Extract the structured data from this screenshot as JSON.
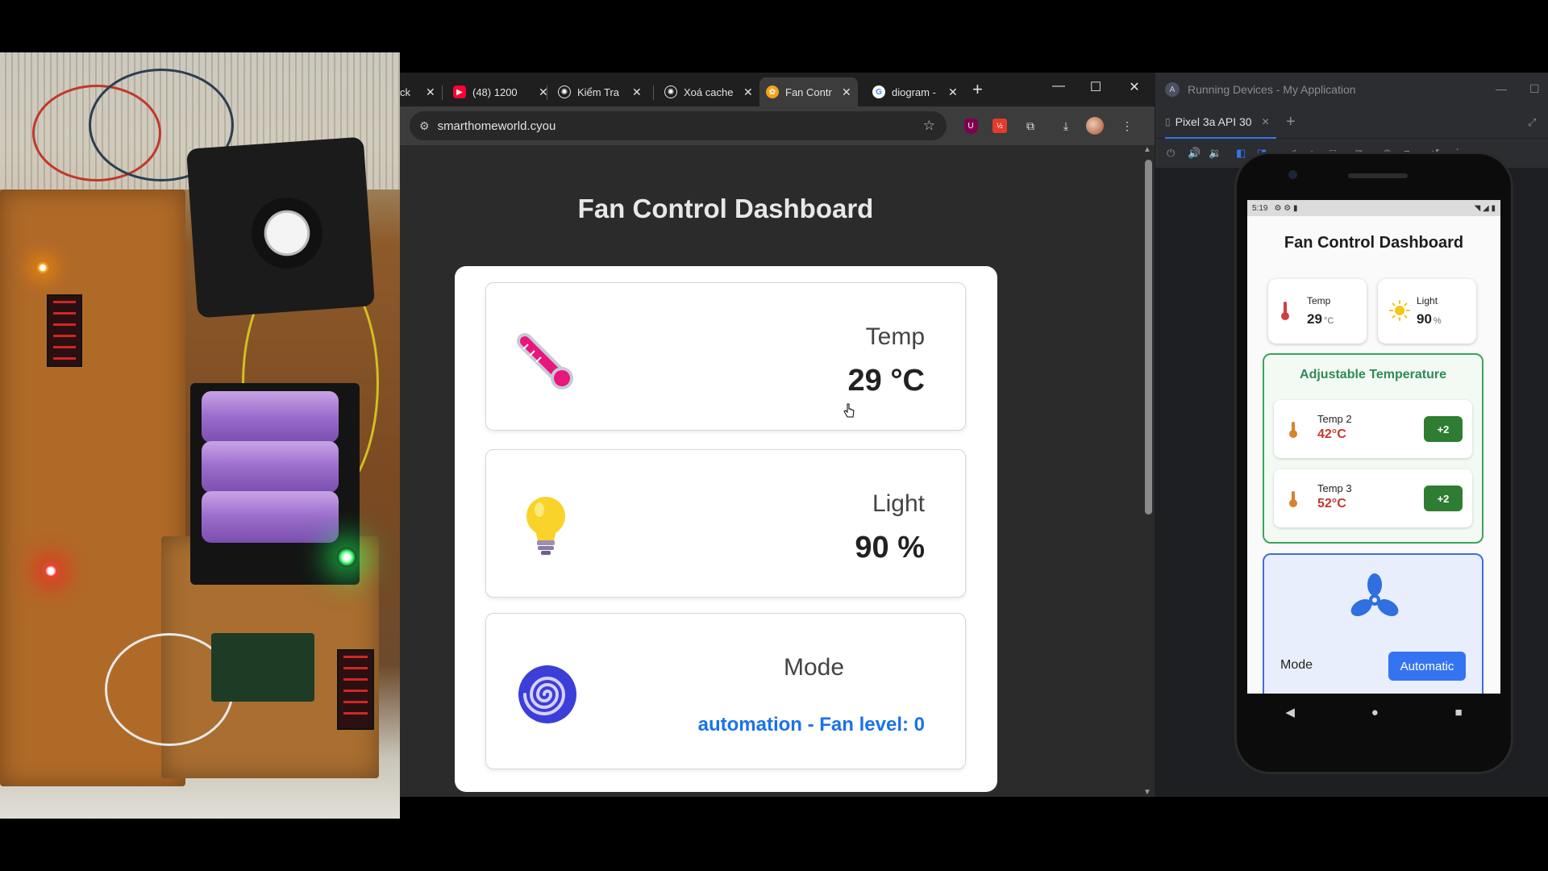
{
  "browser": {
    "tabs": [
      {
        "label": "ck",
        "favicon": "partial-tab"
      },
      {
        "label": "(48) 1200",
        "favicon": "youtube-icon"
      },
      {
        "label": "Kiểm Tra C",
        "favicon": "chatgpt-icon"
      },
      {
        "label": "Xoá cache",
        "favicon": "chatgpt-icon"
      },
      {
        "label": "Fan Contr",
        "favicon": "web-icon"
      },
      {
        "label": "diogram -",
        "favicon": "google-icon"
      }
    ],
    "url": "smarthomeworld.cyou"
  },
  "dashboard": {
    "title": "Fan Control Dashboard",
    "temp_label": "Temp",
    "temp_value": "29 °C",
    "light_label": "Light",
    "light_value": "90 %",
    "mode_label": "Mode",
    "mode_value": "automation - Fan level: 0"
  },
  "studio": {
    "title": "Running Devices - My Application",
    "device_tab": "Pixel 3a API 30"
  },
  "phone": {
    "time": "5:19",
    "app_title": "Fan Control Dashboard",
    "temp_label": "Temp",
    "temp_value": "29",
    "temp_unit": "°C",
    "light_label": "Light",
    "light_value": "90",
    "light_unit": "%",
    "adjustable_title": "Adjustable Temperature",
    "rows": [
      {
        "name": "Temp 2",
        "temp": "42°C",
        "button": "+2"
      },
      {
        "name": "Temp 3",
        "temp": "52°C",
        "button": "+2"
      }
    ],
    "mode_label": "Mode",
    "mode_button": "Automatic"
  },
  "colors": {
    "accent_blue": "#1a73e8",
    "green": "#2e7d32",
    "red_temp": "#c0392b"
  }
}
